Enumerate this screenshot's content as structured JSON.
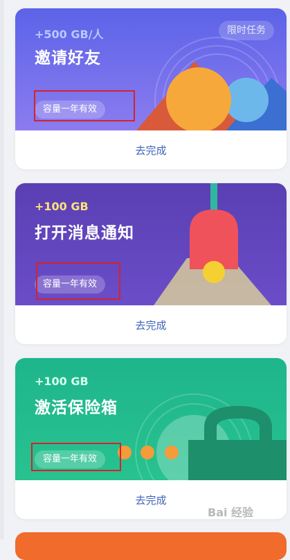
{
  "tasks": [
    {
      "amount": "+500 GB/人",
      "title": "邀请好友",
      "validity": "容量一年有效",
      "tag": "限时任务",
      "action": "去完成"
    },
    {
      "amount": "+100 GB",
      "title": "打开消息通知",
      "validity": "容量一年有效",
      "action": "去完成"
    },
    {
      "amount": "+100 GB",
      "title": "激活保险箱",
      "validity": "容量一年有效",
      "action": "去完成"
    }
  ],
  "watermark": "Bai 经验",
  "colors": {
    "invite_gradient": [
      "#5b63e6",
      "#8a78ee"
    ],
    "notify_gradient": [
      "#5b3fb2",
      "#6c4cc7"
    ],
    "safe_gradient": [
      "#1eb58c",
      "#25c08f"
    ],
    "link": "#3f62b9",
    "highlight_box": "#d3232d"
  }
}
